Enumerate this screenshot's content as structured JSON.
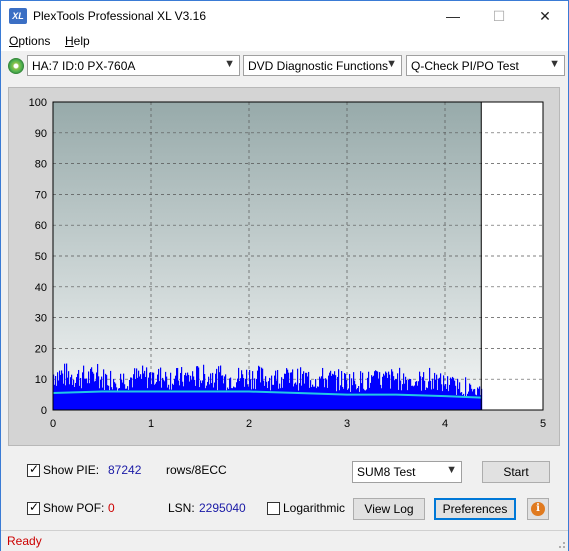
{
  "window": {
    "title": "PlexTools Professional XL V3.16",
    "icon_text": "XL",
    "controls": {
      "minimize": "—",
      "maximize": "☐",
      "close": "✕"
    }
  },
  "menu": {
    "options_label": "Options",
    "help_label": "Help"
  },
  "toolbar": {
    "drive": "HA:7 ID:0  PX-760A",
    "function": "DVD Diagnostic Functions",
    "test": "Q-Check PI/PO Test"
  },
  "chart_data": {
    "type": "bar",
    "xlim": [
      0,
      5
    ],
    "ylim": [
      0,
      100
    ],
    "x_ticks": [
      "0",
      "1",
      "2",
      "3",
      "4",
      "5"
    ],
    "y_ticks": [
      "0",
      "10",
      "20",
      "30",
      "40",
      "50",
      "60",
      "70",
      "80",
      "90",
      "100"
    ],
    "grid": true,
    "data_end_x": 4.37,
    "marker_x": 4.37,
    "series": [
      {
        "color": "#0000ff",
        "x": [
          0.0,
          0.25,
          0.5,
          0.75,
          1.0,
          1.25,
          1.5,
          1.75,
          2.0,
          2.25,
          2.5,
          2.75,
          3.0,
          3.25,
          3.5,
          3.75,
          4.0,
          4.25,
          4.37
        ],
        "values": [
          16,
          15,
          14,
          14,
          15,
          14,
          15,
          14,
          15,
          14,
          14,
          14,
          13,
          13,
          14,
          13,
          12,
          9,
          8
        ]
      },
      {
        "color": "#22c8e6",
        "x": [
          0.0,
          0.5,
          1.0,
          1.5,
          2.0,
          2.5,
          3.0,
          3.5,
          4.0,
          4.37
        ],
        "values": [
          5.5,
          6,
          6,
          6,
          6,
          5.5,
          5,
          5,
          4.5,
          4
        ]
      }
    ]
  },
  "bottom": {
    "show_pie_label": "Show PIE:",
    "pie_value": "87242",
    "rows_label": "rows/8ECC",
    "show_pof_label": "Show POF:",
    "pof_value": "0",
    "lsn_label": "LSN:",
    "lsn_value": "2295040",
    "logarithmic_label": "Logarithmic",
    "test_select": "SUM8 Test",
    "start_label": "Start",
    "view_log_label": "View Log",
    "preferences_label": "Preferences",
    "info_glyph": "i"
  },
  "status": {
    "text": "Ready"
  }
}
